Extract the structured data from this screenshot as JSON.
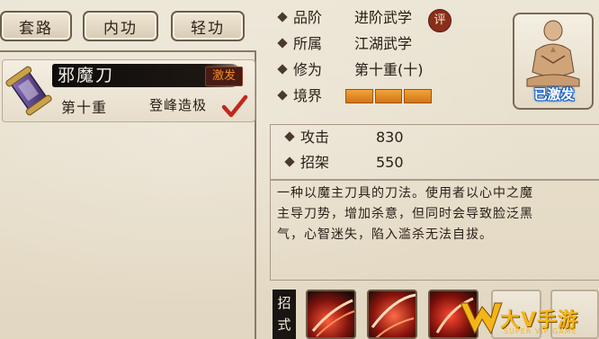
{
  "tabs": [
    {
      "label": "套路",
      "active": false
    },
    {
      "label": "内功",
      "active": false
    },
    {
      "label": "轻功",
      "active": false
    }
  ],
  "skill_list": {
    "items": [
      {
        "name": "邪魔刀",
        "badge": "激发",
        "level": "第十重",
        "realm": "登峰造极",
        "selected": true,
        "icon": "scroll-icon"
      }
    ]
  },
  "details": {
    "rank": {
      "label": "品阶",
      "value": "进阶武学",
      "badge": "评"
    },
    "owner": {
      "label": "所属",
      "value": "江湖武学"
    },
    "cultivation": {
      "label": "修为",
      "value": "第十重(十)"
    },
    "realm": {
      "label": "境界",
      "filled_segments": 3,
      "total_segments": 3
    }
  },
  "portrait": {
    "label": "已激发",
    "icon": "meditating-monk-icon"
  },
  "stats": [
    {
      "label": "攻击",
      "value": "830"
    },
    {
      "label": "招架",
      "value": "550"
    }
  ],
  "description": {
    "lines": [
      "一种以魔主刀具的刀法。使用者以心中之魔",
      "主导刀势，增加杀意，但同时会导致脸泛黑",
      "气，心智迷失，陷入滥杀无法自拔。"
    ]
  },
  "moves": {
    "label": "招式",
    "slots": [
      {
        "icon": "red-slash-icon",
        "filled": true
      },
      {
        "icon": "red-slash-icon",
        "filled": true
      },
      {
        "icon": "red-slash-icon",
        "filled": true
      },
      {
        "icon": "",
        "filled": false
      },
      {
        "icon": "",
        "filled": false
      }
    ]
  },
  "watermark": {
    "text": "大V手游",
    "sub": "SUPER VIP GAME"
  },
  "colors": {
    "realm_fill": "#e08a24",
    "badge_orange": "#f08a2a",
    "portrait_label": "#1b62c5",
    "watermark": "#f3b619"
  }
}
